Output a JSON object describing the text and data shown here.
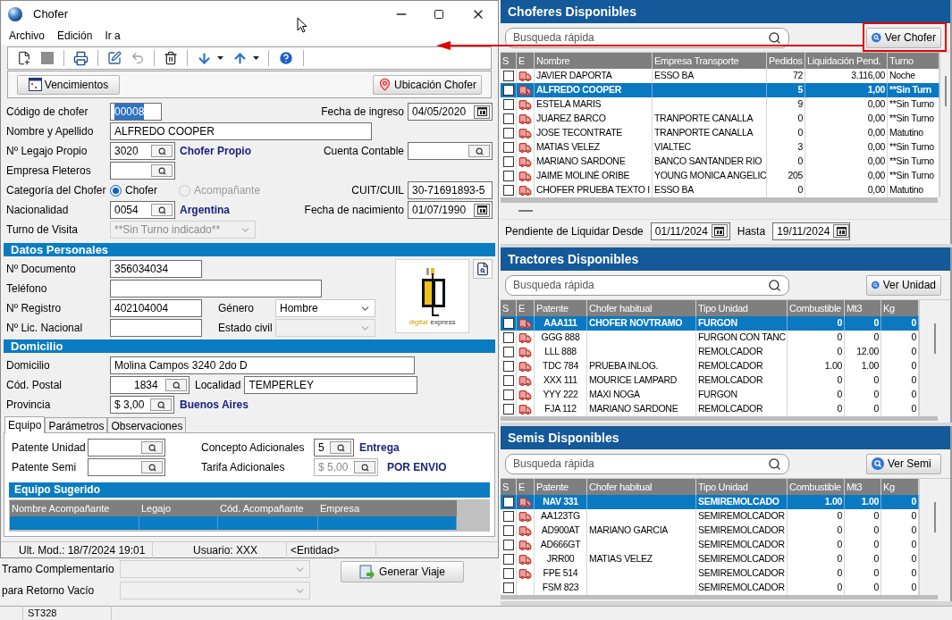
{
  "window": {
    "title": "Chofer"
  },
  "menu": [
    {
      "label": "Archivo"
    },
    {
      "label": "Edición"
    },
    {
      "label": "Ir a"
    }
  ],
  "toolbar": [
    {
      "kind": "new",
      "disabled": false
    },
    {
      "kind": "stop",
      "disabled": false
    },
    {
      "kind": "print",
      "disabled": false
    },
    {
      "kind": "edit",
      "disabled": false
    },
    {
      "kind": "undo",
      "disabled": true
    },
    {
      "kind": "delete",
      "disabled": false
    },
    {
      "kind": "down",
      "disabled": false
    },
    {
      "kind": "up",
      "disabled": false
    },
    {
      "kind": "help",
      "disabled": false
    }
  ],
  "actions": [
    {
      "kind": "calendar",
      "label": "Vencimientos"
    },
    {
      "kind": "pin",
      "label": "Ubicación Chofer"
    }
  ],
  "general": {
    "codigo": {
      "label": "Código de chofer",
      "value": "00008",
      "text_selected": true
    },
    "fecha_ingreso": {
      "label": "Fecha de ingreso",
      "value": "04/05/2020"
    },
    "nombre": {
      "label": "Nombre y Apellido",
      "value": "ALFREDO COOPER"
    },
    "legajo": {
      "label": "Nº Legajo Propio",
      "value": "3020",
      "note": "Chofer Propio"
    },
    "cuenta": {
      "label": "Cuenta Contable"
    },
    "empresa": {
      "label": "Empresa Fleteros"
    },
    "categoria": {
      "label": "Categoría del Chofer",
      "options": [
        {
          "label": "Chofer",
          "selected": true,
          "disabled": false
        },
        {
          "label": "Acompañante",
          "selected": false,
          "disabled": true
        }
      ]
    },
    "cuit": {
      "label": "CUIT/CUIL",
      "value": "30-71691893-5"
    },
    "nacionalidad": {
      "label": "Nacionalidad",
      "value": "0054",
      "note": "Argentina"
    },
    "fecha_nacimiento": {
      "label": "Fecha de nacimiento",
      "value": "01/07/1990"
    },
    "turno": {
      "label": "Turno de Visita",
      "value": "**Sin Turno indicado**",
      "disabled": true
    }
  },
  "datos_personales": {
    "title": "Datos Personales",
    "documento": {
      "label": "Nº Documento",
      "value": "356034034"
    },
    "telefono": {
      "label": "Teléfono"
    },
    "registro": {
      "label": "Nº Registro",
      "value": "402104004"
    },
    "genero": {
      "label": "Género",
      "value": "Hombre",
      "disabled": false
    },
    "licencia": {
      "label": "Nº Lic. Nacional"
    },
    "estado_civil": {
      "label": "Estado civil",
      "disabled": true
    },
    "logo": {
      "words": [
        "digital",
        "express"
      ]
    }
  },
  "domicilio": {
    "title": "Domicilio",
    "domicilio": {
      "label": "Domicilio",
      "value": "Molina Campos 3240 2do D"
    },
    "cod_postal": {
      "label": "Cód. Postal",
      "value": "1834"
    },
    "localidad": {
      "label": "Localidad",
      "value": "TEMPERLEY"
    },
    "provincia": {
      "label": "Provincia",
      "value": "$ 3,00",
      "note": "Buenos Aires"
    }
  },
  "tabs": [
    {
      "label": "Equipo",
      "selected": true
    },
    {
      "label": "Parámetros",
      "selected": false
    },
    {
      "label": "Observaciones",
      "selected": false
    }
  ],
  "equipo": {
    "patente_unidad": {
      "label": "Patente Unidad"
    },
    "patente_semi": {
      "label": "Patente Semi"
    },
    "concepto": {
      "label": "Concepto Adicionales",
      "value": "5",
      "note": "Entrega"
    },
    "tarifa": {
      "label": "Tarifa Adicionales",
      "value": "$ 5,00",
      "note": "POR ENVIO",
      "disabled": true
    },
    "sugerido": {
      "title": "Equipo Sugerido",
      "columns": [
        "Nombre Acompañante",
        "Legajo",
        "Cód. Acompañante",
        "Empresa"
      ],
      "rows": [
        {
          "selected": true
        }
      ]
    }
  },
  "dialog_status": [
    "Ult. Mod.: 18/7/2024 19:01",
    "Usuario: XXX",
    "<Entidad>"
  ],
  "parent_form": {
    "rows": [
      {
        "label": "Tramo Complementario"
      },
      {
        "label": "para Retorno Vacío"
      }
    ],
    "button": "Generar Viaje"
  },
  "panels": [
    {
      "title": "Choferes Disponibles",
      "search_placeholder": "Busqueda rápida",
      "button": "Ver Chofer",
      "columns": [
        {
          "label": "S",
          "kind": "check"
        },
        {
          "label": "E",
          "kind": "icon"
        },
        {
          "label": "Nombre",
          "kind": "text"
        },
        {
          "label": "Empresa Transporte",
          "kind": "text"
        },
        {
          "label": "Pedidos",
          "kind": "number"
        },
        {
          "label": "Liquidación Pend.",
          "kind": "number"
        },
        {
          "label": "Turno",
          "kind": "text"
        }
      ],
      "rows": [
        {
          "selected": false,
          "checked": false,
          "truck": true,
          "cells": [
            null,
            null,
            "JAVIER DAPORTA",
            "ESSO BA",
            "72",
            "3.116,00",
            "Noche"
          ]
        },
        {
          "selected": true,
          "checked": false,
          "truck": true,
          "cells": [
            null,
            null,
            "ALFREDO COOPER",
            null,
            "5",
            "1,00",
            "**Sin Turn"
          ]
        },
        {
          "selected": false,
          "checked": false,
          "truck": true,
          "cells": [
            null,
            null,
            "ESTELA MARIS",
            null,
            "9",
            "0,00",
            "**Sin Turno"
          ]
        },
        {
          "selected": false,
          "checked": false,
          "truck": true,
          "cells": [
            null,
            null,
            "JUAREZ BARCO",
            "TRANPORTE CANALLA",
            "0",
            "0,00",
            "**Sin Turno"
          ]
        },
        {
          "selected": false,
          "checked": false,
          "truck": true,
          "cells": [
            null,
            null,
            "JOSE TECONTRATE",
            "TRANPORTE CANALLA",
            "0",
            "0,00",
            "Matutino"
          ]
        },
        {
          "selected": false,
          "checked": false,
          "truck": true,
          "cells": [
            null,
            null,
            "MATIAS VELEZ",
            "VIALTEC",
            "3",
            "0,00",
            "**Sin Turno"
          ]
        },
        {
          "selected": false,
          "checked": false,
          "truck": true,
          "cells": [
            null,
            null,
            "MARIANO SARDONE",
            "BANCO SANTANDER RIO",
            "0",
            "0,00",
            "**Sin Turno"
          ]
        },
        {
          "selected": false,
          "checked": false,
          "truck": true,
          "cells": [
            null,
            null,
            "JAIME MOLINÉ ORIBE",
            "YOUNG MONICA ANGELIC",
            "205",
            "0,00",
            "**Sin Turno"
          ]
        },
        {
          "selected": false,
          "checked": false,
          "truck": true,
          "cells": [
            null,
            null,
            "CHOFER PRUEBA TEXTO I",
            "ESSO BA",
            "0",
            "0,00",
            "Matutino"
          ]
        }
      ],
      "footer": {
        "label": "Pendiente de Liquidar Desde",
        "from": "01/11/2024",
        "to_label": "Hasta",
        "to": "19/11/2024"
      }
    },
    {
      "title": "Tractores Disponibles",
      "search_placeholder": "Busqueda rápida",
      "button": "Ver Unidad",
      "columns": [
        {
          "label": "S",
          "kind": "check"
        },
        {
          "label": "E",
          "kind": "icon"
        },
        {
          "label": "Patente",
          "kind": "center"
        },
        {
          "label": "Chofer habitual",
          "kind": "text"
        },
        {
          "label": "Tipo Unidad",
          "kind": "text"
        },
        {
          "label": "Combustible",
          "kind": "number"
        },
        {
          "label": "Mt3",
          "kind": "number"
        },
        {
          "label": "Kg",
          "kind": "number"
        }
      ],
      "rows": [
        {
          "selected": true,
          "checked": false,
          "truck": true,
          "cells": [
            null,
            null,
            "AAA111",
            "CHOFER NOVTRAMO",
            "FURGON",
            "0",
            "0",
            "0"
          ]
        },
        {
          "selected": false,
          "checked": false,
          "truck": true,
          "cells": [
            null,
            null,
            "GGG 888",
            null,
            "FURGON CON TANC",
            "0",
            "0",
            "0"
          ]
        },
        {
          "selected": false,
          "checked": false,
          "truck": true,
          "cells": [
            null,
            null,
            "LLL 888",
            null,
            "REMOLCADOR",
            "0",
            "12.00",
            "0"
          ]
        },
        {
          "selected": false,
          "checked": false,
          "truck": true,
          "cells": [
            null,
            null,
            "TDC 784",
            "PRUEBA INLOG.",
            "REMOLCADOR",
            "1.00",
            "1.00",
            "0"
          ]
        },
        {
          "selected": false,
          "checked": false,
          "truck": true,
          "cells": [
            null,
            null,
            "XXX 111",
            "MOURICE LAMPARD",
            "REMOLCADOR",
            "0",
            "0",
            "0"
          ]
        },
        {
          "selected": false,
          "checked": false,
          "truck": true,
          "cells": [
            null,
            null,
            "YYY 222",
            "MAXI NOGA",
            "FURGON",
            "0",
            "0",
            "0"
          ]
        },
        {
          "selected": false,
          "checked": false,
          "truck": true,
          "cells": [
            null,
            null,
            "FJA 112",
            "MARIANO SARDONE",
            "REMOLCADOR",
            "0",
            "0",
            "0"
          ]
        }
      ]
    },
    {
      "title": "Semis Disponibles",
      "search_placeholder": "Busqueda rápida",
      "button": "Ver Semi",
      "columns": [
        {
          "label": "S",
          "kind": "check"
        },
        {
          "label": "E",
          "kind": "icon"
        },
        {
          "label": "Patente",
          "kind": "center"
        },
        {
          "label": "Chofer habitual",
          "kind": "text"
        },
        {
          "label": "Tipo Unidad",
          "kind": "text"
        },
        {
          "label": "Combustible",
          "kind": "number"
        },
        {
          "label": "Mt3",
          "kind": "number"
        },
        {
          "label": "Kg",
          "kind": "number"
        }
      ],
      "rows": [
        {
          "selected": true,
          "checked": false,
          "truck": true,
          "cells": [
            null,
            null,
            "NAV 331",
            null,
            "SEMIREMOLCADO",
            "1.00",
            "1.00",
            "0"
          ]
        },
        {
          "selected": false,
          "checked": false,
          "truck": true,
          "cells": [
            null,
            null,
            "AA123TG",
            null,
            "SEMIREMOLCADOR",
            "0",
            "0",
            "0"
          ]
        },
        {
          "selected": false,
          "checked": false,
          "truck": true,
          "cells": [
            null,
            null,
            "AD900AT",
            "MARIANO GARCIA",
            "SEMIREMOLCADOR",
            "0",
            "0",
            "0"
          ]
        },
        {
          "selected": false,
          "checked": false,
          "truck": true,
          "cells": [
            null,
            null,
            "AD666GT",
            null,
            "SEMIREMOLCADOR",
            "0",
            "0",
            "0"
          ]
        },
        {
          "selected": false,
          "checked": false,
          "truck": true,
          "cells": [
            null,
            null,
            "JRR00",
            "MATIAS VELEZ",
            "SEMIREMOLCADOR",
            "0",
            "0",
            "0"
          ]
        },
        {
          "selected": false,
          "checked": false,
          "truck": true,
          "cells": [
            null,
            null,
            "FPE 514",
            null,
            "SEMIREMOLCADOR",
            "0",
            "0",
            "0"
          ]
        },
        {
          "selected": false,
          "checked": false,
          "truck": false,
          "cells": [
            null,
            null,
            "FSM 823",
            null,
            "SEMIREMOLCADOR",
            "0",
            "0",
            "0"
          ]
        }
      ]
    }
  ],
  "status_bar": [
    "ST328"
  ]
}
